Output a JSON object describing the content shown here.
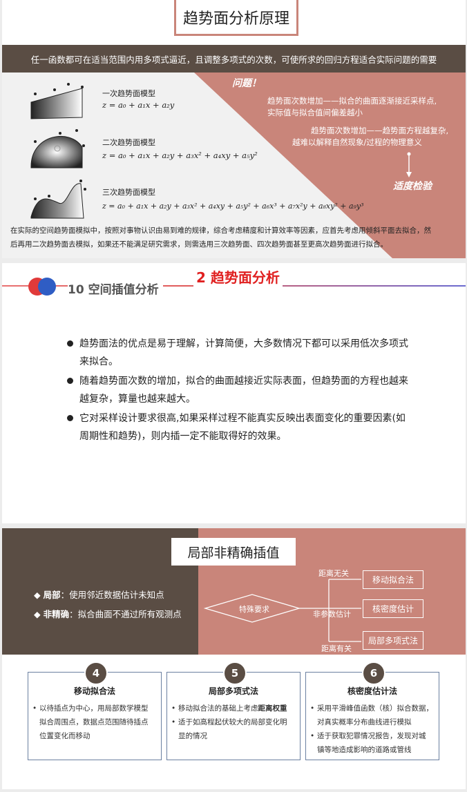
{
  "slide1": {
    "title": "趋势面分析原理",
    "banner": "任一函数都可在适当范围内用多项式逼近，且调整多项式的次数，可使所求的回归方程适合实际问题的需要",
    "models": [
      {
        "label": "一次趋势面模型",
        "formula": "z = a₀ + a₁x + a₂y"
      },
      {
        "label": "二次趋势面模型",
        "formula": "z = a₀ + a₁x + a₂y + a₃x² + a₄xy + a₅y²"
      },
      {
        "label": "三次趋势面模型",
        "formula": "z = a₀ + a₁x + a₂y + a₃x² + a₄xy + a₅y² + a₆x³ + a₇x²y + a₈xy² + a₉y³"
      }
    ],
    "problem_title": "问题！",
    "problem1_line1": "趋势面次数增加——拟合的曲面逐渐接近采样点,",
    "problem1_line2": "实际值与拟合值间偏差越小",
    "problem2_line1": "趋势面次数增加——趋势面方程越复杂,",
    "problem2_line2": "越难以解释自然现象/过程的物理意义",
    "test_label": "适度检验",
    "footer_line1": "在实际的空间趋势面模拟中，按照对事物认识由易到难的规律，综合考虑精度和计算效率等因素，应首先考虑用倾斜平面去拟合，然",
    "footer_line2": "后再用二次趋势面去模拟，如果还不能满足研究需求，则需选用三次趋势面、四次趋势面甚至更高次趋势面进行拟合。"
  },
  "slide2": {
    "section": "10 空间插值分析",
    "heading": "2 趋势面分析",
    "bullets": [
      {
        "l1": "趋势面法的优点是易于理解，计算简便，大多数情况下都可以采用低次多项式",
        "l2": "来拟合。"
      },
      {
        "l1": "随着趋势面次数的增加，拟合的曲面越接近实际表面，但趋势面的方程也越来",
        "l2": "越复杂，算量也越来越大。"
      },
      {
        "l1": "它对采样设计要求很高,如果采样过程不能真实反映出表面变化的重要因素(如",
        "l2": "周期性和趋势)，则内插一定不能取得好的效果。"
      }
    ]
  },
  "slide3": {
    "title": "局部非精确插值",
    "local_key": "局部",
    "local_text": "：使用邻近数据估计未知点",
    "inexact_key": "非精确",
    "inexact_text": "：拟合曲面不通过所有观测点",
    "special": "特殊要求",
    "nonparam": "非参数估计",
    "dist_irrelevant": "距离无关",
    "dist_relevant": "距离有关",
    "methods": [
      "移动拟合法",
      "核密度估计",
      "局部多项式法"
    ],
    "cards": [
      {
        "num": "4",
        "title": "移动拟合法",
        "items": [
          [
            "以待插点为中心，用局部数学模型",
            "拟合周围点，数据点范围随待插点",
            "位置变化而移动"
          ]
        ]
      },
      {
        "num": "5",
        "title": "局部多项式法",
        "items": [
          [
            "移动拟合法的基础上考虑",
            "距离权重"
          ],
          [
            "适于如高程起伏较大的局部变化明",
            "显的情况"
          ]
        ]
      },
      {
        "num": "6",
        "title": "核密度估计法",
        "items": [
          [
            "采用平滑峰值函数（核）拟合数据，",
            "对真实概率分布曲线进行模拟"
          ],
          [
            "适于获取犯罪情况报告，发现对城",
            "镇等地造成影响的道路或管线"
          ]
        ]
      }
    ]
  },
  "colors": {
    "brown": "#5a4d44",
    "rose": "#c9857a",
    "red": "#e02020"
  }
}
